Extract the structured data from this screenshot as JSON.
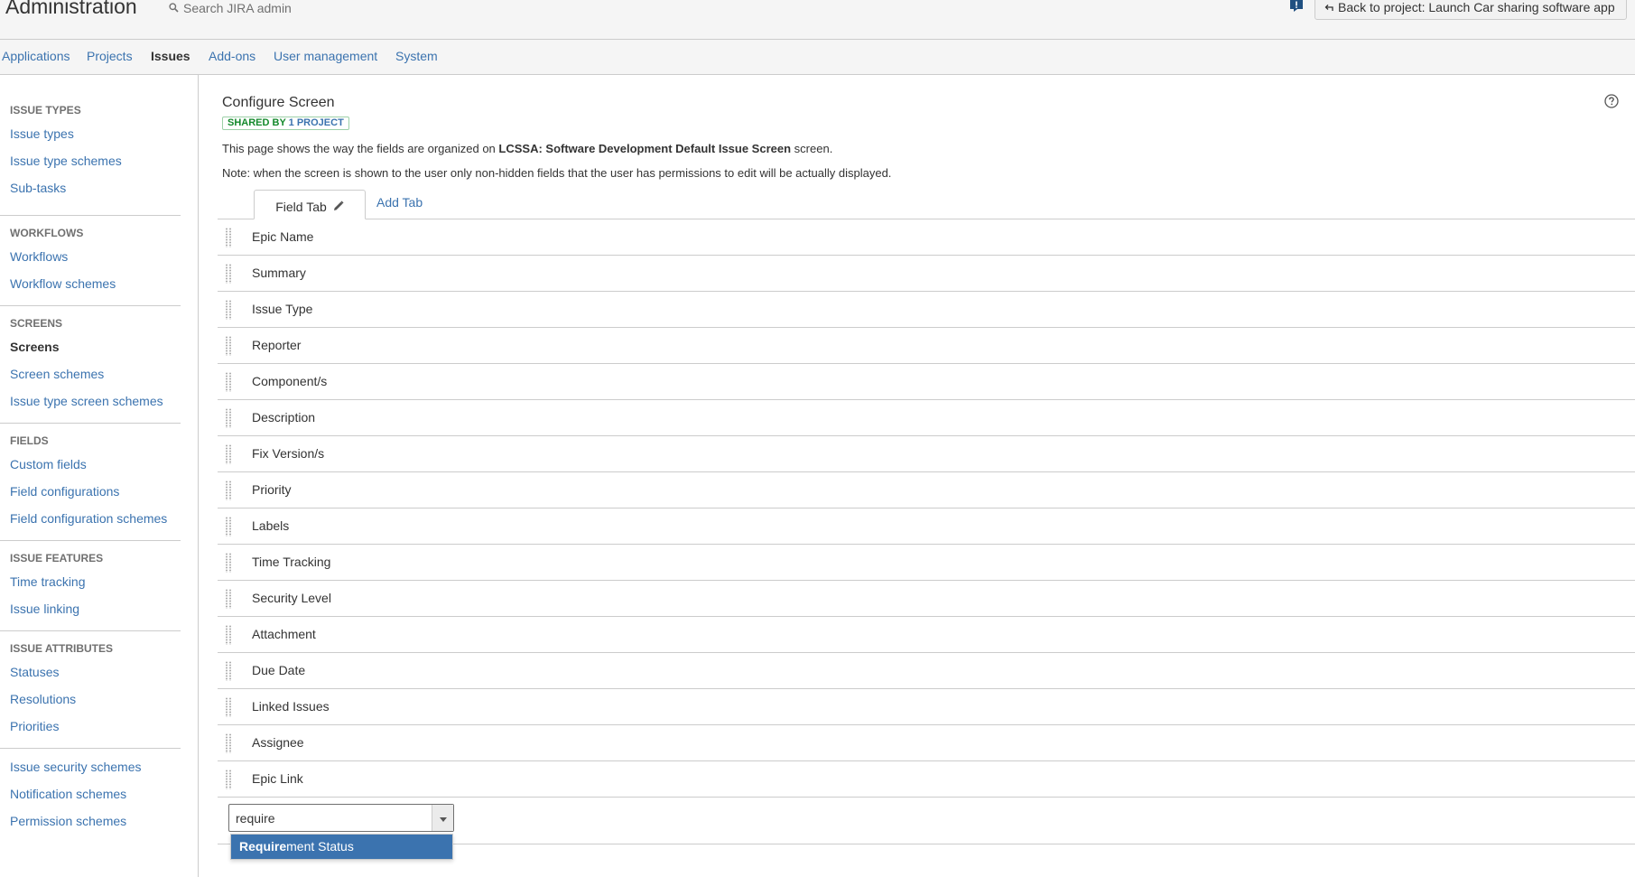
{
  "header": {
    "title": "Administration",
    "search_placeholder": "Search JIRA admin",
    "back_button": "Back to project: Launch Car sharing software app"
  },
  "topnav": [
    {
      "label": "Applications",
      "active": false
    },
    {
      "label": "Projects",
      "active": false
    },
    {
      "label": "Issues",
      "active": true
    },
    {
      "label": "Add-ons",
      "active": false
    },
    {
      "label": "User management",
      "active": false
    },
    {
      "label": "System",
      "active": false
    }
  ],
  "sidebar": {
    "sections": [
      {
        "heading": "ISSUE TYPES",
        "items": [
          "Issue types",
          "Issue type schemes",
          "Sub-tasks"
        ]
      },
      {
        "heading": "WORKFLOWS",
        "items": [
          "Workflows",
          "Workflow schemes"
        ]
      },
      {
        "heading": "SCREENS",
        "items": [
          "Screens",
          "Screen schemes",
          "Issue type screen schemes"
        ]
      },
      {
        "heading": "FIELDS",
        "items": [
          "Custom fields",
          "Field configurations",
          "Field configuration schemes"
        ]
      },
      {
        "heading": "ISSUE FEATURES",
        "items": [
          "Time tracking",
          "Issue linking"
        ]
      },
      {
        "heading": "ISSUE ATTRIBUTES",
        "items": [
          "Statuses",
          "Resolutions",
          "Priorities"
        ]
      },
      {
        "heading": "",
        "items": [
          "Issue security schemes",
          "Notification schemes",
          "Permission schemes"
        ]
      }
    ],
    "active_item": "Screens"
  },
  "main": {
    "title": "Configure Screen",
    "shared_badge_prefix": "SHARED BY ",
    "shared_badge_link": "1 PROJECT",
    "desc_prefix": "This page shows the way the fields are organized on ",
    "desc_screen_name": "LCSSA: Software Development Default Issue Screen",
    "desc_suffix": " screen.",
    "note": "Note: when the screen is shown to the user only non-hidden fields that the user has permissions to edit will be actually displayed.",
    "tabs": {
      "field_tab": "Field Tab",
      "add_tab": "Add Tab"
    },
    "fields": [
      "Epic Name",
      "Summary",
      "Issue Type",
      "Reporter",
      "Component/s",
      "Description",
      "Fix Version/s",
      "Priority",
      "Labels",
      "Time Tracking",
      "Security Level",
      "Attachment",
      "Due Date",
      "Linked Issues",
      "Assignee",
      "Epic Link"
    ],
    "add_field": {
      "input_value": "require",
      "suggestion_match": "Require",
      "suggestion_rest": "ment Status"
    }
  },
  "colors": {
    "link": "#3b73af",
    "selected_suggestion": "#3b73af",
    "badge_green": "#14892c"
  }
}
